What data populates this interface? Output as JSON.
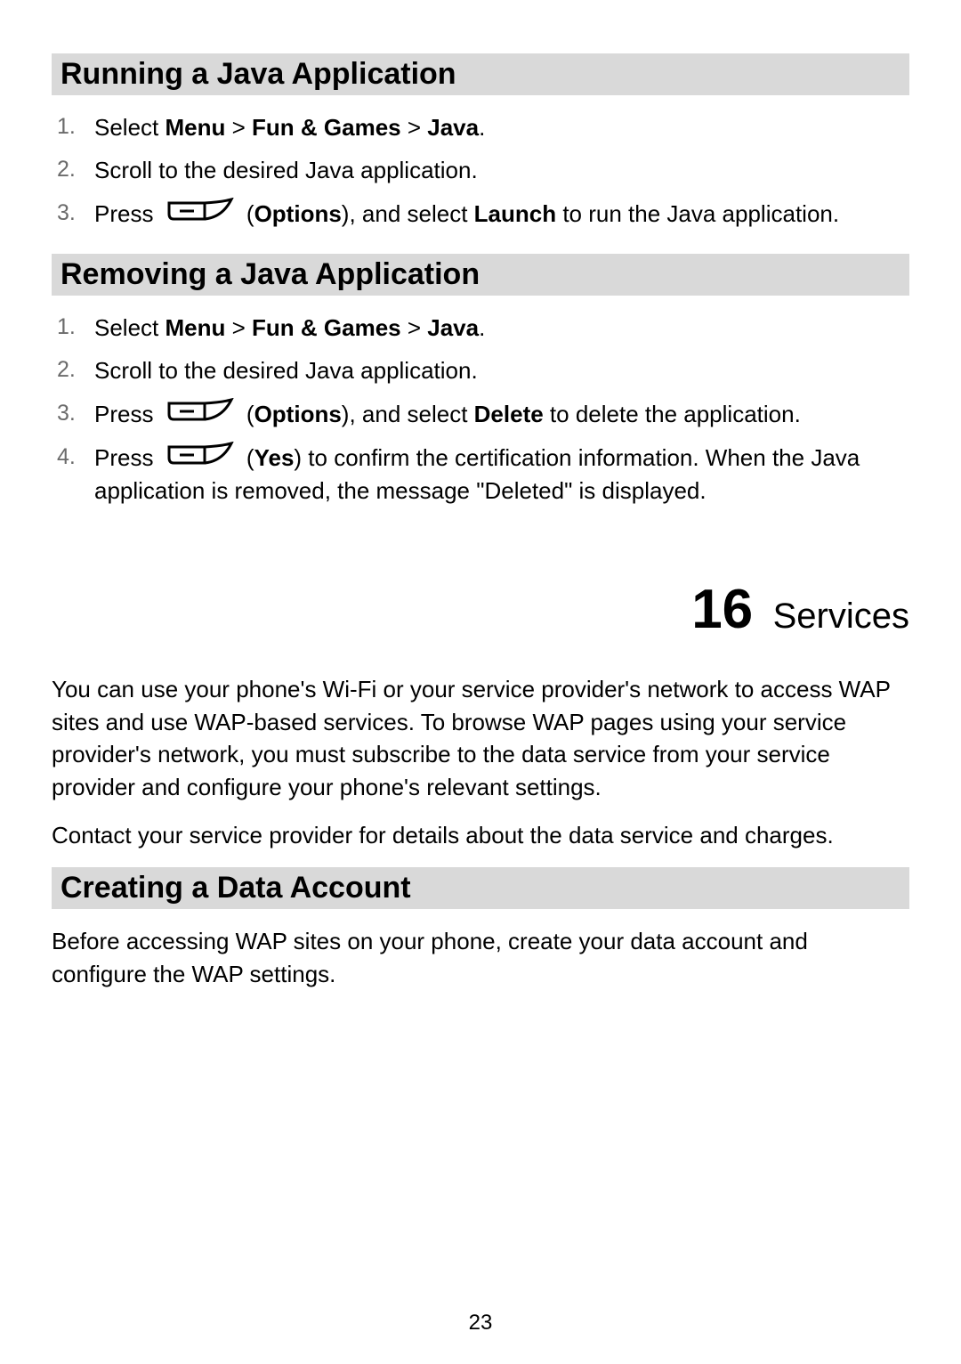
{
  "section1": {
    "heading": "Running a Java Application",
    "step1_prefix": "Select ",
    "step1_b1": "Menu",
    "step1_sep1": " > ",
    "step1_b2": "Fun & Games",
    "step1_sep2": " > ",
    "step1_b3": "Java",
    "step1_suffix": ".",
    "step2": "Scroll to the desired Java application.",
    "step3_prefix": "Press ",
    "step3_mid1": " (",
    "step3_b1": "Options",
    "step3_mid2": "), and select ",
    "step3_b2": "Launch",
    "step3_suffix": " to run the Java application."
  },
  "section2": {
    "heading": "Removing a Java Application",
    "step1_prefix": "Select ",
    "step1_b1": "Menu",
    "step1_sep1": " > ",
    "step1_b2": "Fun & Games",
    "step1_sep2": " > ",
    "step1_b3": "Java",
    "step1_suffix": ".",
    "step2": "Scroll to the desired Java application.",
    "step3_prefix": "Press ",
    "step3_mid1": " (",
    "step3_b1": "Options",
    "step3_mid2": "), and select ",
    "step3_b2": "Delete",
    "step3_suffix": " to delete the application.",
    "step4_prefix": "Press ",
    "step4_mid1": " (",
    "step4_b1": "Yes",
    "step4_suffix": ") to confirm the certification information. When the Java application is removed, the message \"Deleted\" is displayed."
  },
  "chapter": {
    "number": "16",
    "title": "Services"
  },
  "body": {
    "para1": "You can use your phone's Wi-Fi or your service provider's network to access WAP sites and use WAP-based services. To browse WAP pages using your service provider's network, you must subscribe to the data service from your service provider and configure your phone's relevant settings.",
    "para2": "Contact your service provider for details about the data service and charges."
  },
  "section3": {
    "heading": "Creating a Data Account",
    "para": "Before accessing WAP sites on your phone, create your data account and configure the WAP settings."
  },
  "page_number": "23"
}
